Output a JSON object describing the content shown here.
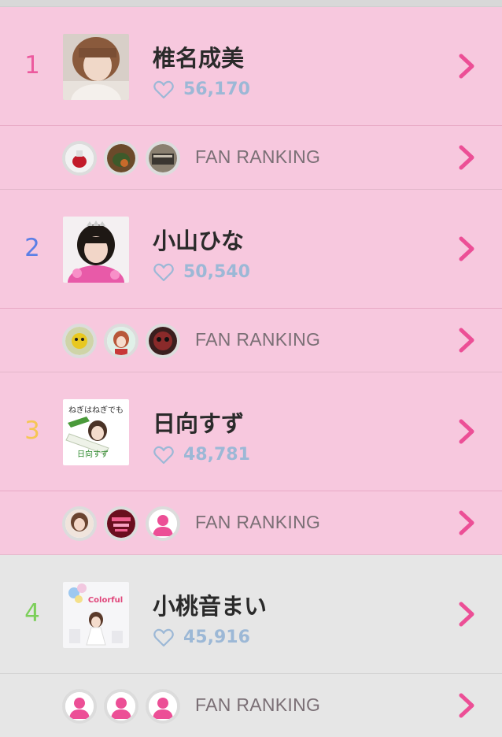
{
  "entries": [
    {
      "rank": "1",
      "rank_color": "#ec5a9e",
      "name": "椎名成美",
      "likes": "56,170",
      "fan_label": "FAN RANKING",
      "fans": [
        "photo-fan-icon",
        "photo-fan-icon",
        "photo-fan-icon"
      ]
    },
    {
      "rank": "2",
      "rank_color": "#5b7fe6",
      "name": "小山ひな",
      "likes": "50,540",
      "fan_label": "FAN RANKING",
      "fans": [
        "photo-fan-icon",
        "photo-fan-icon",
        "photo-fan-icon"
      ]
    },
    {
      "rank": "3",
      "rank_color": "#f5c654",
      "name": "日向すず",
      "likes": "48,781",
      "fan_label": "FAN RANKING",
      "fans": [
        "photo-fan-icon",
        "photo-fan-icon",
        "default-user-icon"
      ]
    },
    {
      "rank": "4",
      "rank_color": "#7ccf5a",
      "name": "小桃音まい",
      "likes": "45,916",
      "fan_label": "FAN RANKING",
      "fans": [
        "default-user-icon",
        "default-user-icon",
        "default-user-icon"
      ]
    }
  ],
  "thumb_texts": {
    "entry3_top": "ねぎはねぎでも",
    "entry3_bottom": "日向すず",
    "entry4_logo": "Colorful"
  },
  "colors": {
    "accent_pink": "#ec4f96",
    "likes_blue": "#9cb8d6"
  }
}
